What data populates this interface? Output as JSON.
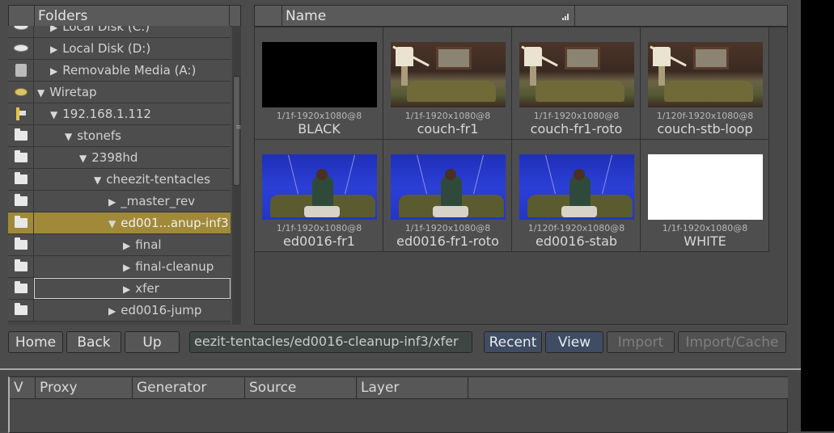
{
  "folders": {
    "title": "Folders",
    "items": [
      {
        "label": "Local Disk (C:)",
        "icon": "disk-icon"
      },
      {
        "label": "Local Disk (D:)",
        "icon": "disk-icon"
      },
      {
        "label": "Removable Media (A:)",
        "icon": "removable-media-icon"
      },
      {
        "label": "Wiretap",
        "icon": "wiretap-icon"
      },
      {
        "label": "192.168.1.112",
        "icon": "network-host-icon"
      },
      {
        "label": "stonefs",
        "icon": "folder-icon"
      },
      {
        "label": "2398hd",
        "icon": "folder-icon"
      },
      {
        "label": "cheezit-tentacles",
        "icon": "folder-icon"
      },
      {
        "label": "_master_rev",
        "icon": "folder-icon"
      },
      {
        "label": "ed001...anup-inf3",
        "icon": "folder-icon",
        "selected": true
      },
      {
        "label": "final",
        "icon": "folder-icon"
      },
      {
        "label": "final-cleanup",
        "icon": "folder-icon"
      },
      {
        "label": "xfer",
        "icon": "folder-icon",
        "focused": true
      },
      {
        "label": "ed0016-jump",
        "icon": "folder-icon"
      }
    ]
  },
  "browser": {
    "column_name": "Name",
    "clips": [
      {
        "info": "1/1f-1920x1080@8",
        "name": "BLACK"
      },
      {
        "info": "1/1f-1920x1080@8",
        "name": "couch-fr1"
      },
      {
        "info": "1/1f-1920x1080@8",
        "name": "couch-fr1-roto"
      },
      {
        "info": "1/120f-1920x1080@8",
        "name": "couch-stb-loop"
      },
      {
        "info": "1/1f-1920x1080@8",
        "name": "ed0016-fr1"
      },
      {
        "info": "1/1f-1920x1080@8",
        "name": "ed0016-fr1-roto"
      },
      {
        "info": "1/120f-1920x1080@8",
        "name": "ed0016-stab"
      },
      {
        "info": "1/1f-1920x1080@8",
        "name": "WHITE"
      }
    ]
  },
  "toolbar": {
    "home": "Home",
    "back": "Back",
    "up": "Up",
    "path": "eezit-tentacles/ed0016-cleanup-inf3/xfer",
    "recent": "Recent",
    "view": "View",
    "import": "Import",
    "import_cache": "Import/Cache"
  },
  "layers": {
    "columns": [
      "V",
      "Proxy",
      "Generator",
      "Source",
      "Layer"
    ]
  }
}
